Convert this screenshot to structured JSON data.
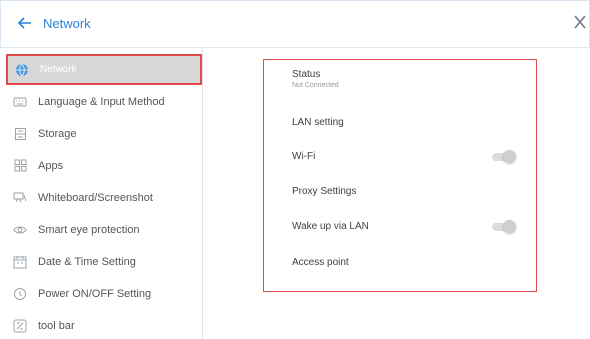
{
  "header": {
    "title": "Network",
    "back_icon": "arrow-left-icon",
    "close_icon": "close-icon",
    "accent_color": "#2b84d6"
  },
  "sidebar": {
    "items": [
      {
        "label": "Network",
        "icon": "globe-icon",
        "active": true
      },
      {
        "label": "Language & Input Method",
        "icon": "keyboard-icon",
        "active": false
      },
      {
        "label": "Storage",
        "icon": "storage-icon",
        "active": false
      },
      {
        "label": "Apps",
        "icon": "apps-grid-icon",
        "active": false
      },
      {
        "label": "Whiteboard/Screenshot",
        "icon": "whiteboard-icon",
        "active": false
      },
      {
        "label": "Smart eye protection",
        "icon": "eye-icon",
        "active": false
      },
      {
        "label": "Date & Time Setting",
        "icon": "calendar-icon",
        "active": false
      },
      {
        "label": "Power ON/OFF Setting",
        "icon": "power-timer-icon",
        "active": false
      },
      {
        "label": "tool bar",
        "icon": "toolbar-icon",
        "active": false
      }
    ]
  },
  "main": {
    "rows": [
      {
        "label": "Status",
        "sub": "Not Connected"
      },
      {
        "label": "LAN setting"
      },
      {
        "label": "Wi-Fi",
        "toggle": "off"
      },
      {
        "label": "Proxy Settings"
      },
      {
        "label": "Wake up via LAN",
        "toggle": "off"
      },
      {
        "label": "Access point"
      }
    ]
  },
  "colors": {
    "highlight_border": "#e24b4b",
    "active_bg": "#d7d7d7"
  }
}
